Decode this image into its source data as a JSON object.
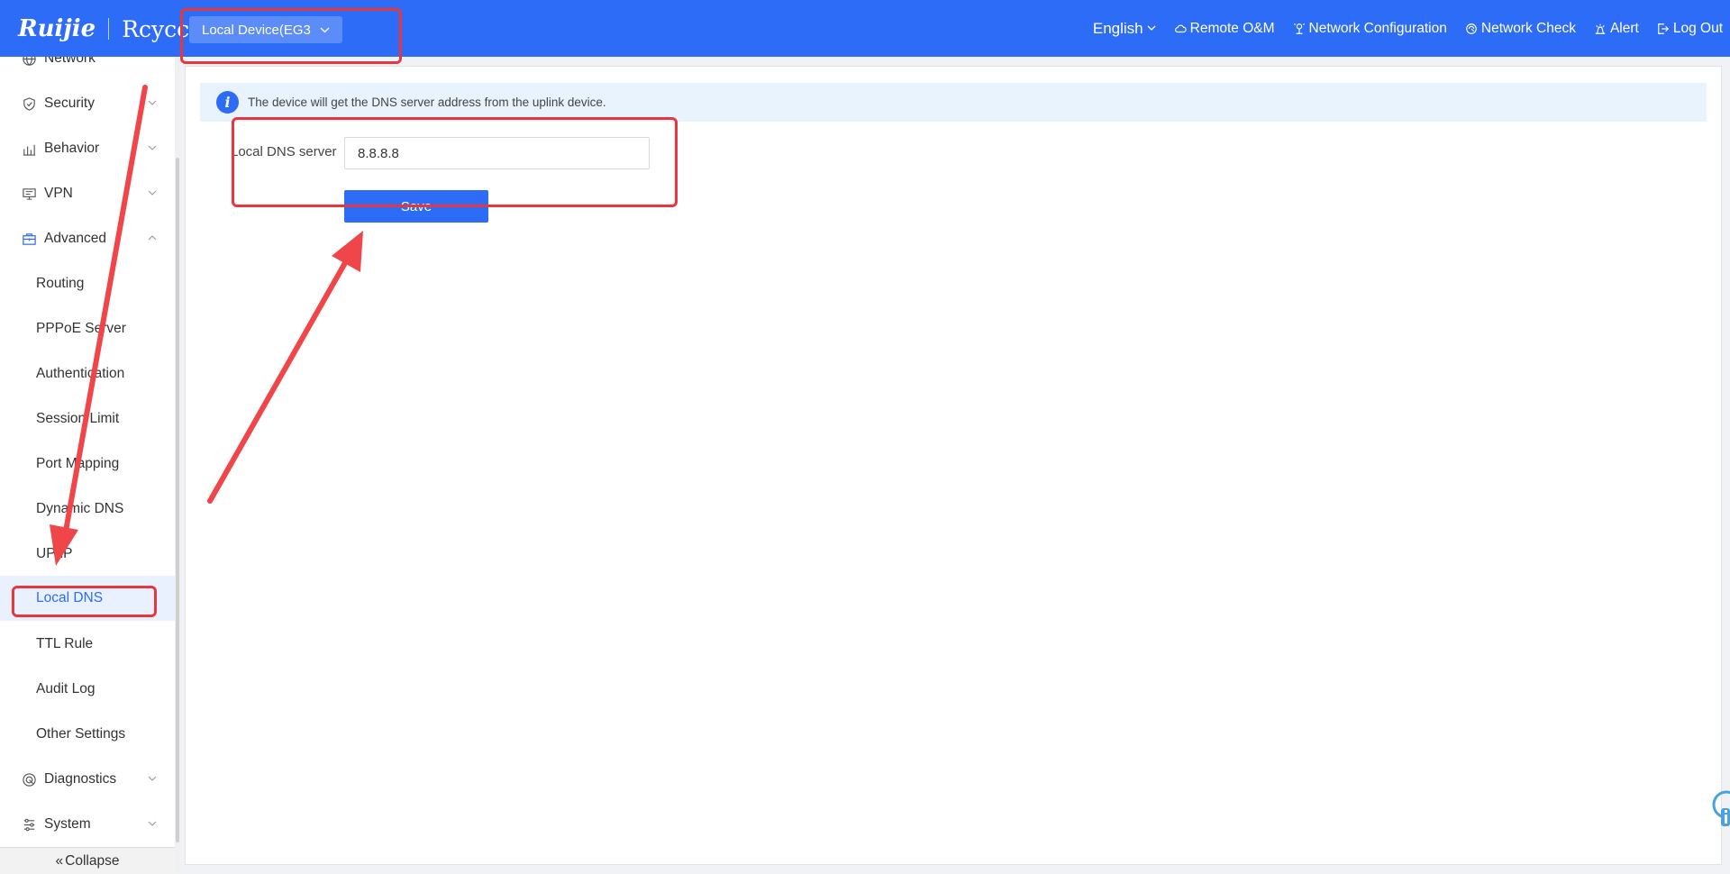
{
  "header": {
    "brand": "Ruijie",
    "product": "Rcycc",
    "device_select": "Local Device(EG3",
    "language": "English",
    "nav": {
      "remote": "Remote O&M",
      "netconfig": "Network Configuration",
      "netcheck": "Network Check",
      "alert": "Alert",
      "logout": "Log Out"
    }
  },
  "sidebar": {
    "network_partial": "Network",
    "security": "Security",
    "behavior": "Behavior",
    "vpn": "VPN",
    "advanced": "Advanced",
    "advanced_items": [
      "Routing",
      "PPPoE Server",
      "Authentication",
      "Session Limit",
      "Port Mapping",
      "Dynamic DNS",
      "UPnP",
      "Local DNS",
      "TTL Rule",
      "Audit Log",
      "Other Settings"
    ],
    "active_item": "Local DNS",
    "diagnostics": "Diagnostics",
    "system": "System",
    "collapse": "Collapse"
  },
  "main": {
    "info_text": "The device will get the DNS server address from the uplink device.",
    "field_label": "Local DNS server",
    "dns_value": "8.8.8.8",
    "save_label": "Save"
  },
  "colors": {
    "accent": "#2d6cf6",
    "annotation_red": "#e8363d",
    "info_bg": "#e8f3fd"
  }
}
